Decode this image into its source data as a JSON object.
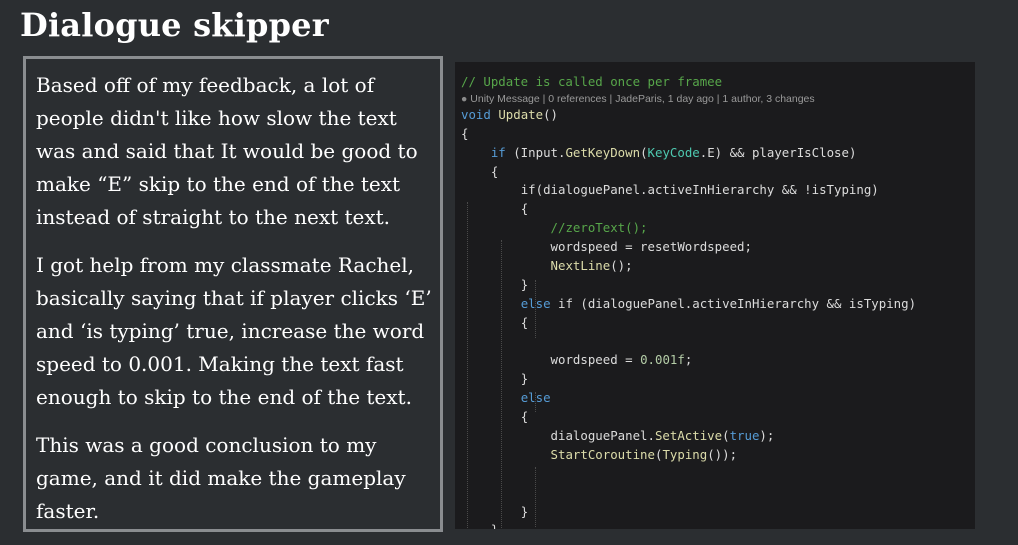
{
  "title": "Dialogue skipper",
  "paragraphs": [
    "Based off of my feedback, a lot of people didn't like how slow the text was and said that It would be good to make “E” skip to the end of the text instead of straight to the next text.",
    "I got help from my classmate Rachel, basically saying that if player clicks ‘E’ and ‘is typing’ true, increase the word speed to 0.001. Making the text fast enough to skip to the end of the text.",
    "This was a good conclusion to my game, and it did make the gameplay faster."
  ],
  "code": {
    "comment": "// Update is called once per framee",
    "meta": "Unity Message | 0 references | JadeParis, 1 day ago | 1 author, 3 changes",
    "void_kw": "void",
    "update_name": "Update",
    "parens": "()",
    "open_brace": "{",
    "close_brace": "}",
    "if_kw": "if",
    "cond1_a": " (Input.",
    "getkeydown": "GetKeyDown",
    "cond1_b": "(",
    "keycode": "KeyCode",
    "cond1_c": ".E) && playerIsClose)",
    "if2": "if(dialoguePanel.activeInHierarchy && !isTyping)",
    "zero_comment": "//zeroText();",
    "wordspeed_reset": "wordspeed = resetWordspeed;",
    "nextline": "NextLine",
    "nextline_tail": "();",
    "else_kw": "else",
    "elseif_rest": " if (dialoguePanel.activeInHierarchy && isTyping)",
    "wordspeed_set": "wordspeed = ",
    "speed_value": "0.001f",
    "semicolon": ";",
    "setactive_a": "dialoguePanel.",
    "setactive": "SetActive",
    "true_kw": "true",
    "setactive_tail": ");",
    "startcoroutine": "StartCoroutine",
    "typing": "Typing",
    "coroutine_tail": "());"
  }
}
